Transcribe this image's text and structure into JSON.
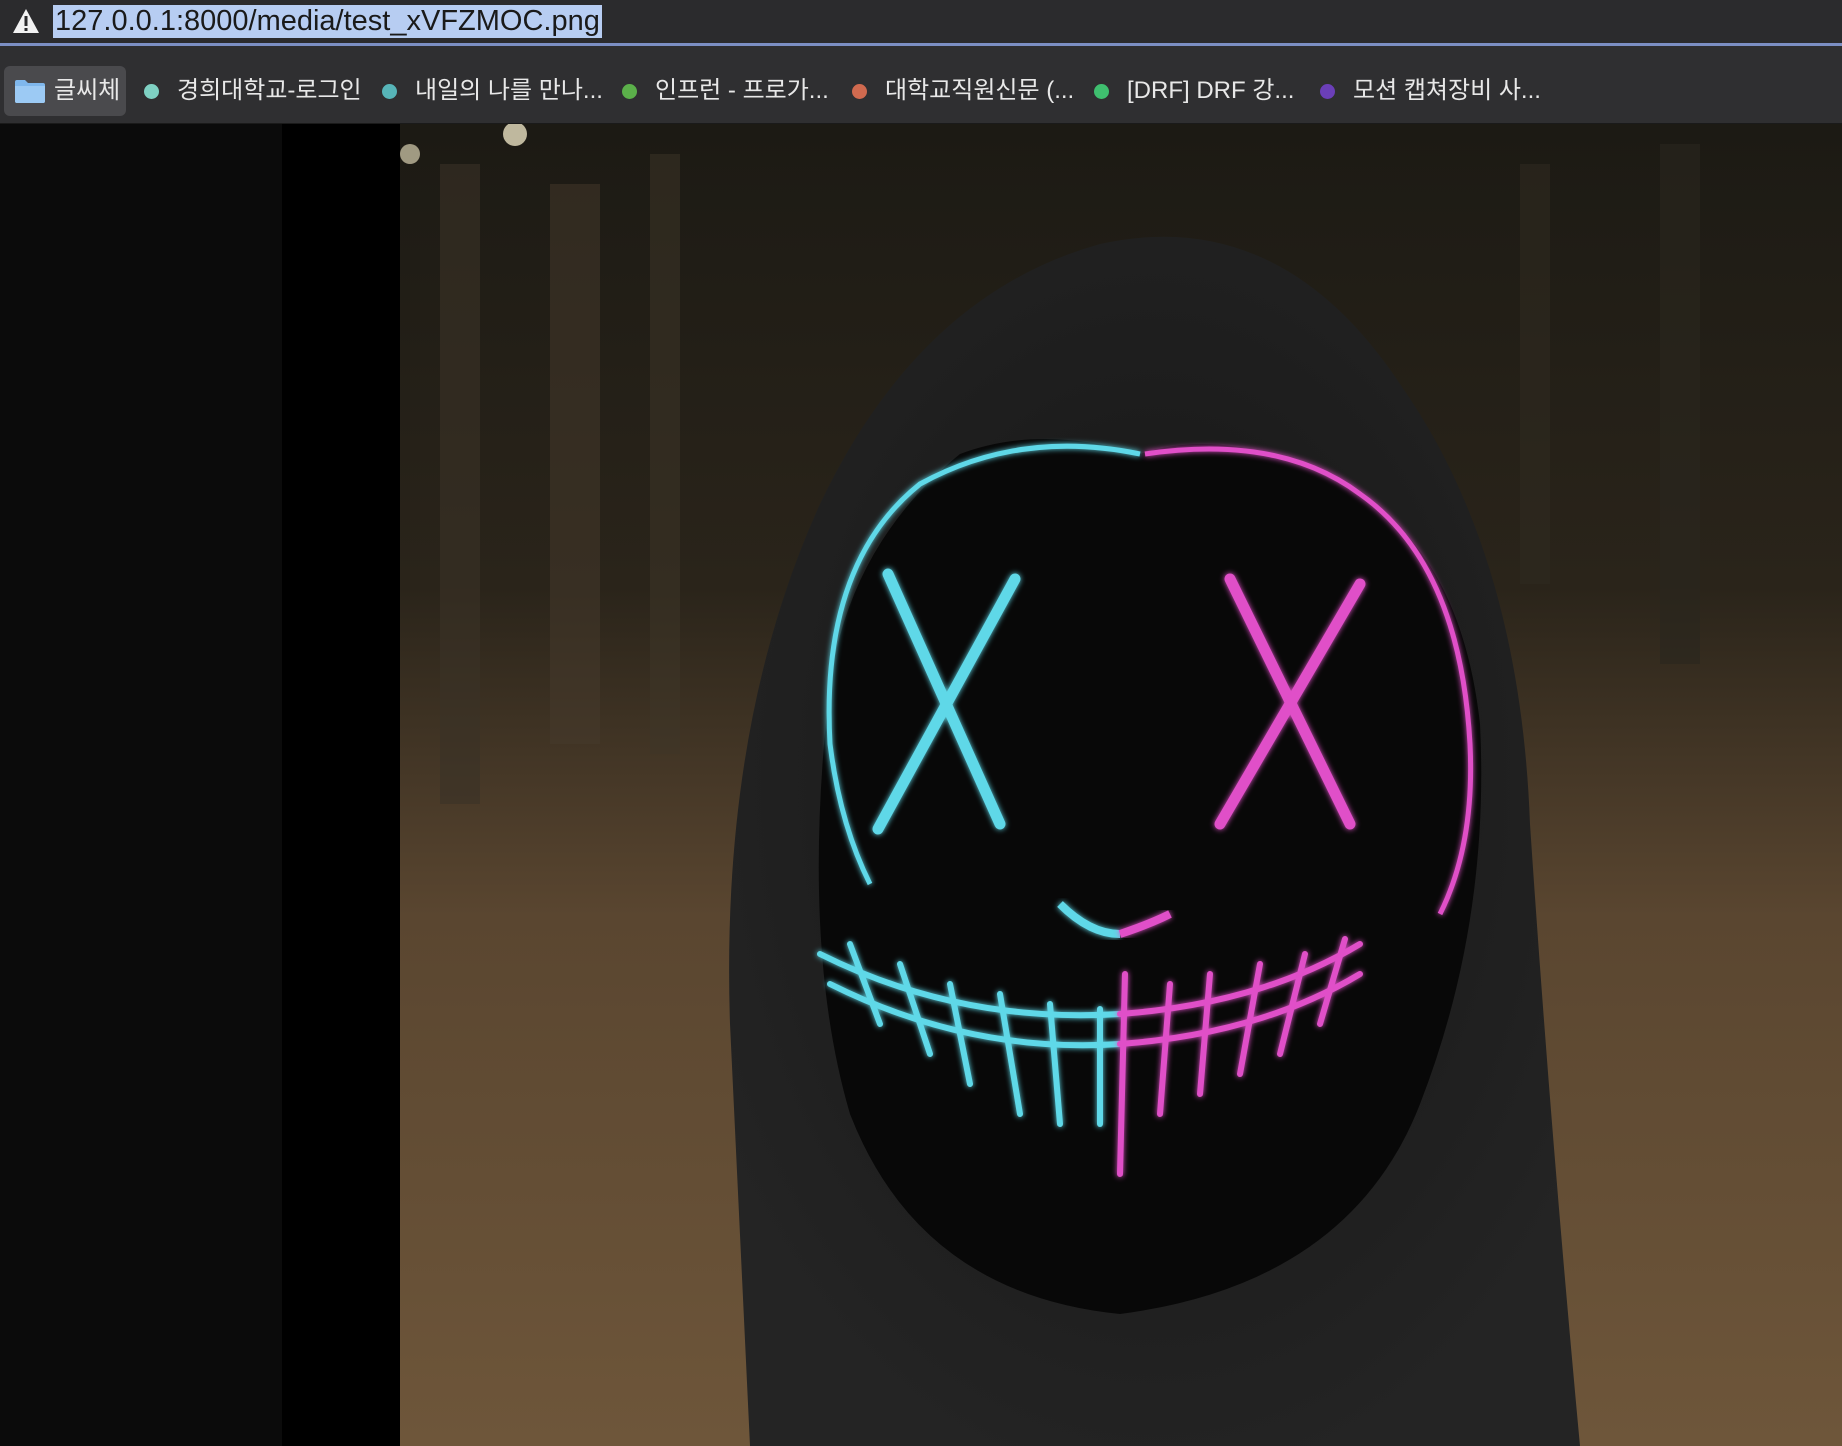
{
  "url_bar": {
    "url": "127.0.0.1:8000/media/test_xVFZMOC.png",
    "warning_icon": "warning-triangle-icon"
  },
  "bookmarks": {
    "folder": {
      "label": "글씨체",
      "icon": "folder-icon"
    },
    "items": [
      {
        "label": "경희대학교-로그인",
        "dot_color": "#7fd1c3"
      },
      {
        "label": "내일의 나를 만나...",
        "dot_color": "#57b5b8"
      },
      {
        "label": "인프런 - 프로가...",
        "dot_color": "#5bb04a"
      },
      {
        "label": "대학교직원신문 (...",
        "dot_color": "#d06a4f"
      },
      {
        "label": "[DRF] DRF 강...",
        "dot_color": "#3fbf6f"
      },
      {
        "label": "모션 캡쳐장비 사...",
        "dot_color": "#6b3fb8"
      }
    ]
  },
  "colors": {
    "mask_cyan": "#5fd8e8",
    "mask_pink": "#e04fc8",
    "selection_highlight": "#b7cdf2"
  }
}
